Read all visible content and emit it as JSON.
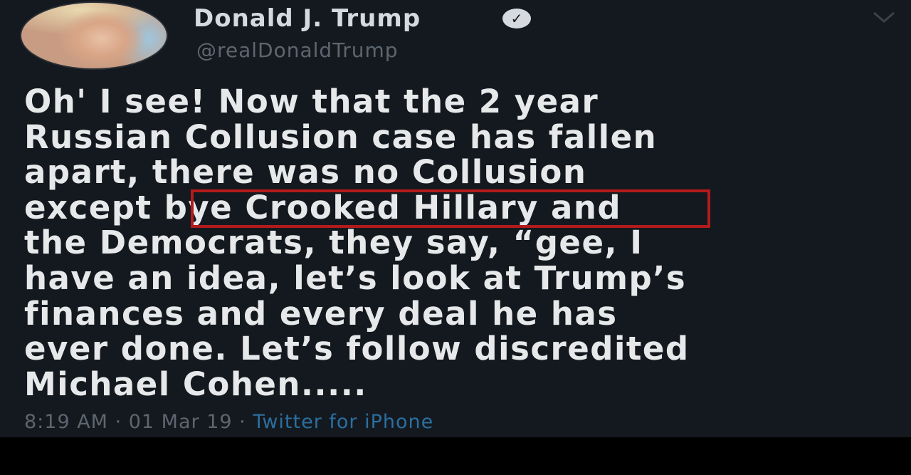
{
  "author": {
    "display_name": "Donald J. Trump",
    "verified_icon": "verified-badge-icon",
    "handle": "@realDonaldTrump"
  },
  "menu": {
    "icon": "chevron-down-icon"
  },
  "tweet": {
    "lines": [
      "Oh' I see! Now that the 2 year",
      "Russian Collusion case has fallen",
      "apart, there was no Collusion",
      "except bye Crooked Hillary and",
      "the Democrats, they say, “gee, I",
      "have an idea, let’s look at Trump’s",
      "finances and every deal he has",
      "ever done. Let’s follow discredited",
      "Michael Cohen....."
    ],
    "highlighted_phrase": "bye Crooked Hillary",
    "highlight_color": "#b31b1b"
  },
  "meta": {
    "time": "8:19 AM",
    "separator": " · ",
    "date": "01 Mar 19",
    "source": "Twitter for iPhone",
    "source_color": "#2b6fa0"
  }
}
